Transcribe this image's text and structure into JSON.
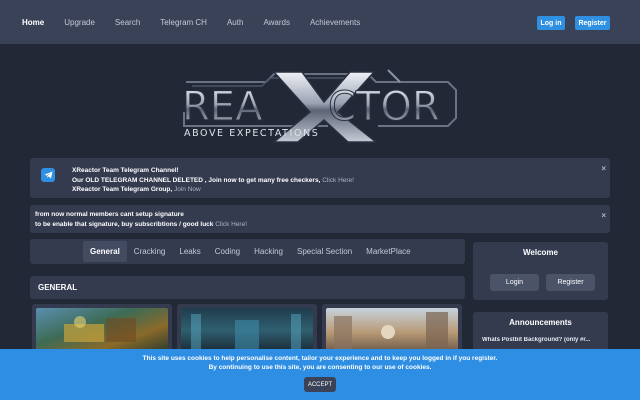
{
  "nav": {
    "links": [
      "Home",
      "Upgrade",
      "Search",
      "Telegram CH",
      "Auth",
      "Awards",
      "Achievements"
    ],
    "login_label": "Log in",
    "register_label": "Register"
  },
  "logo": {
    "text": "REAXCTOR",
    "tagline": "ABOVE EXPECTATIONS"
  },
  "notice1": {
    "line1": "XReactor Team Telegram Channel!",
    "line2_text": "Our OLD TELEGRAM CHANNEL DELETED , Join now to get many free checkers,",
    "line2_link": "Click Here!",
    "line3_text": "XReactor Team Telegram Group,",
    "line3_link": "Join Now",
    "close": "×"
  },
  "notice2": {
    "line1": "from now normal members cant setup signature",
    "line2_text": "to be enable that signature, buy subscribtions / good luck",
    "line2_link": "Click Here!",
    "close": "×"
  },
  "tabs": [
    "General",
    "Cracking",
    "Leaks",
    "Coding",
    "Hacking",
    "Special Section",
    "MarketPlace"
  ],
  "active_tab": "General",
  "welcome": {
    "title": "Welcome",
    "login": "Login",
    "register": "Register"
  },
  "section_title": "GENERAL",
  "announcements": {
    "title": "Announcements",
    "item": "Whats Postbit Background? (only #r..."
  },
  "cookie": {
    "line1": "This site uses cookies to help personalise content, tailor your experience and to keep you logged in if you register.",
    "line2": "By continuing to use this site, you are consenting to our use of cookies.",
    "accept": "ACCEPT"
  },
  "colors": {
    "accent": "#2f8fe0",
    "background": "#232836",
    "panel": "#343b4f",
    "nav": "#3a4258"
  }
}
